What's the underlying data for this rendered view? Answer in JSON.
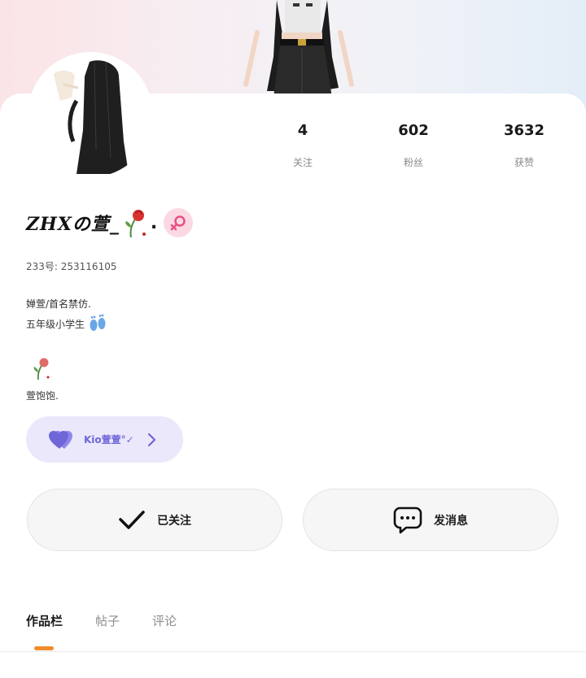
{
  "profile": {
    "username": "ZHXの萱_",
    "gender": "female",
    "uid_label": "233号: 253116105"
  },
  "stats": [
    {
      "value": "4",
      "label": "关注"
    },
    {
      "value": "602",
      "label": "粉丝"
    },
    {
      "value": "3632",
      "label": "获赞"
    }
  ],
  "bio": {
    "line1": "婵萱/首名禁仿.",
    "line2": "五年级小学生",
    "line3": "萱饱饱."
  },
  "fan_group": {
    "name": "Kio萱萱°✓"
  },
  "actions": {
    "follow_label": "已关注",
    "message_label": "发消息"
  },
  "tabs": [
    {
      "label": "作品栏",
      "active": true
    },
    {
      "label": "帖子",
      "active": false
    },
    {
      "label": "评论",
      "active": false
    }
  ],
  "colors": {
    "accent_orange": "#f08c2c",
    "fan_pill_bg": "#ebe8fb",
    "heart_purple": "#6f66d8",
    "gender_badge_bg": "#fbd9e3"
  },
  "icons": {
    "gender": "female-symbol-icon",
    "emoji_rose": "wilted-rose-icon",
    "emoji_feet": "footprints-icon",
    "fan_heart": "double-heart-icon",
    "fan_chevron": "chevron-right-icon",
    "follow": "checkmark-icon",
    "message": "chat-bubble-icon"
  }
}
